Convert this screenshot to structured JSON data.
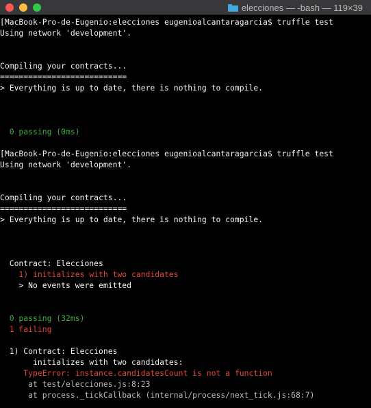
{
  "window": {
    "title": "elecciones — -bash — 119×39",
    "colors": {
      "titlebar": "#38383a",
      "background": "#000000",
      "close": "#fc5753",
      "minimize": "#fdbc40",
      "zoom": "#33c748",
      "folder": "#3fa9e0",
      "text": "#f2f2f2",
      "green": "#3fae3f",
      "red": "#e0443a",
      "gray": "#bdbdbd"
    }
  },
  "terminal": {
    "lines": [
      {
        "text": "[MacBook-Pro-de-Eugenio:elecciones eugenioalcantaragarcia$ truffle test",
        "color": "white"
      },
      {
        "text": "Using network 'development'.",
        "color": "white"
      },
      {
        "text": "",
        "color": "white"
      },
      {
        "text": "",
        "color": "white"
      },
      {
        "text": "Compiling your contracts...",
        "color": "white"
      },
      {
        "text": "===========================",
        "color": "white"
      },
      {
        "text": "> Everything is up to date, there is nothing to compile.",
        "color": "white"
      },
      {
        "text": "",
        "color": "white"
      },
      {
        "text": "",
        "color": "white"
      },
      {
        "text": "",
        "color": "white"
      },
      {
        "text": "  0 passing (0ms)",
        "color": "green"
      },
      {
        "text": "",
        "color": "white"
      },
      {
        "text": "[MacBook-Pro-de-Eugenio:elecciones eugenioalcantaragarcia$ truffle test",
        "color": "white"
      },
      {
        "text": "Using network 'development'.",
        "color": "white"
      },
      {
        "text": "",
        "color": "white"
      },
      {
        "text": "",
        "color": "white"
      },
      {
        "text": "Compiling your contracts...",
        "color": "white"
      },
      {
        "text": "===========================",
        "color": "white"
      },
      {
        "text": "> Everything is up to date, there is nothing to compile.",
        "color": "white"
      },
      {
        "text": "",
        "color": "white"
      },
      {
        "text": "",
        "color": "white"
      },
      {
        "text": "",
        "color": "white"
      },
      {
        "text": "  Contract: Elecciones",
        "color": "white"
      },
      {
        "text": "    1) initializes with two candidates",
        "color": "red"
      },
      {
        "text": "    > No events were emitted",
        "color": "white"
      },
      {
        "text": "",
        "color": "white"
      },
      {
        "text": "",
        "color": "white"
      },
      {
        "text": "  0 passing (32ms)",
        "color": "green"
      },
      {
        "text": "  1 failing",
        "color": "red"
      },
      {
        "text": "",
        "color": "white"
      },
      {
        "text": "  1) Contract: Elecciones",
        "color": "white"
      },
      {
        "text": "       initializes with two candidates:",
        "color": "white"
      },
      {
        "text": "     TypeError: instance.candidatesCount is not a function",
        "color": "red"
      },
      {
        "text": "      at test/elecciones.js:8:23",
        "color": "gray"
      },
      {
        "text": "      at process._tickCallback (internal/process/next_tick.js:68:7)",
        "color": "gray"
      }
    ]
  }
}
